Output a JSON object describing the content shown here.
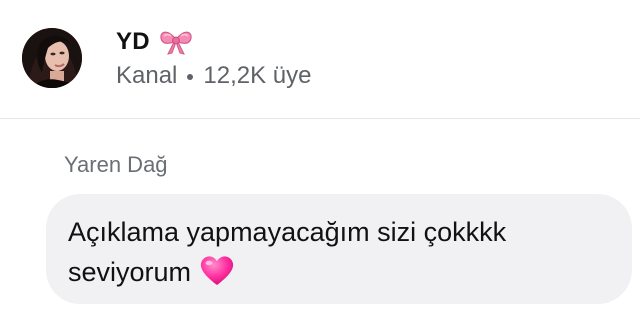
{
  "channel": {
    "name": "YD",
    "name_emoji": "bow-icon",
    "type": "Kanal",
    "members": "12,2K üye",
    "avatar": "avatar-photo"
  },
  "message": {
    "sender": "Yaren Dağ",
    "text_line1": "Açıklama yapmayacağım sizi çokkkk",
    "text_line2": "seviyorum",
    "emoji": "pink-heart-icon"
  },
  "colors": {
    "bubble_background": "#f1f1f3",
    "secondary_text": "#5f6368",
    "heart": "#ff2fa0",
    "bow": "#f58bb2"
  }
}
